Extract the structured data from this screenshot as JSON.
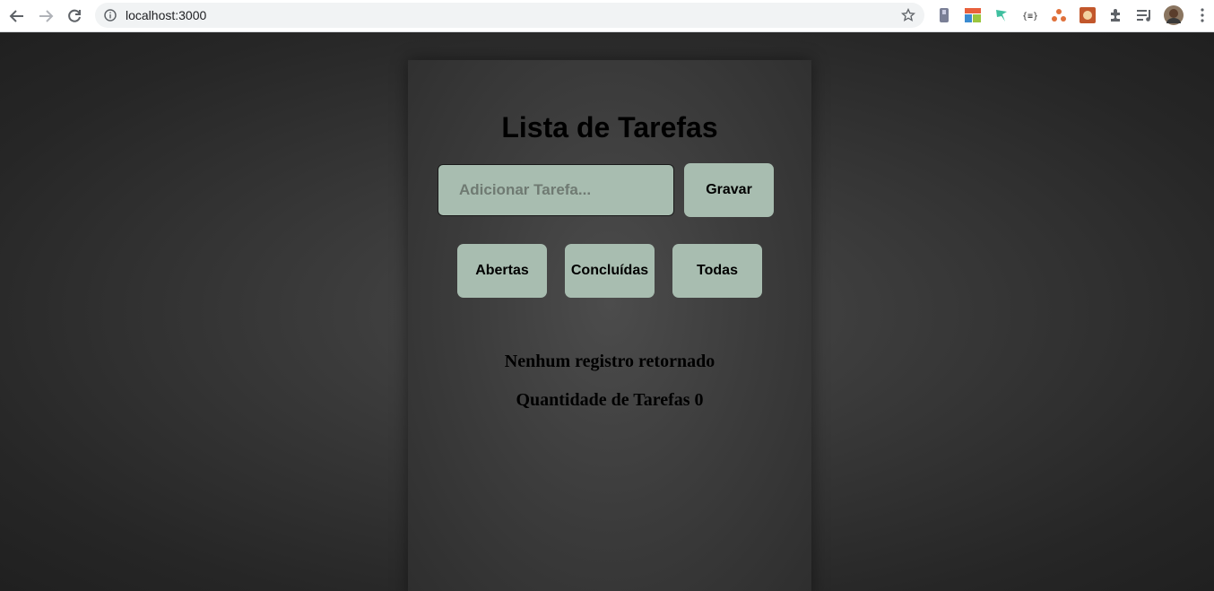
{
  "browser": {
    "url": "localhost:3000",
    "icons": [
      "back-icon",
      "forward-icon",
      "reload-icon",
      "info-icon",
      "star-icon",
      "extension-icon",
      "puzzle-icon",
      "media-icon",
      "profile-avatar",
      "menu-icon"
    ]
  },
  "app": {
    "title": "Lista de Tarefas",
    "input_placeholder": "Adicionar Tarefa...",
    "save_label": "Gravar",
    "filters": [
      "Abertas",
      "Concluídas",
      "Todas"
    ],
    "empty_message": "Nenhum registro retornado",
    "count_label": "Quantidade de Tarefas 0"
  },
  "colors": {
    "button_bg": "#a8bdb0",
    "page_bg": "#2a2a2a"
  }
}
